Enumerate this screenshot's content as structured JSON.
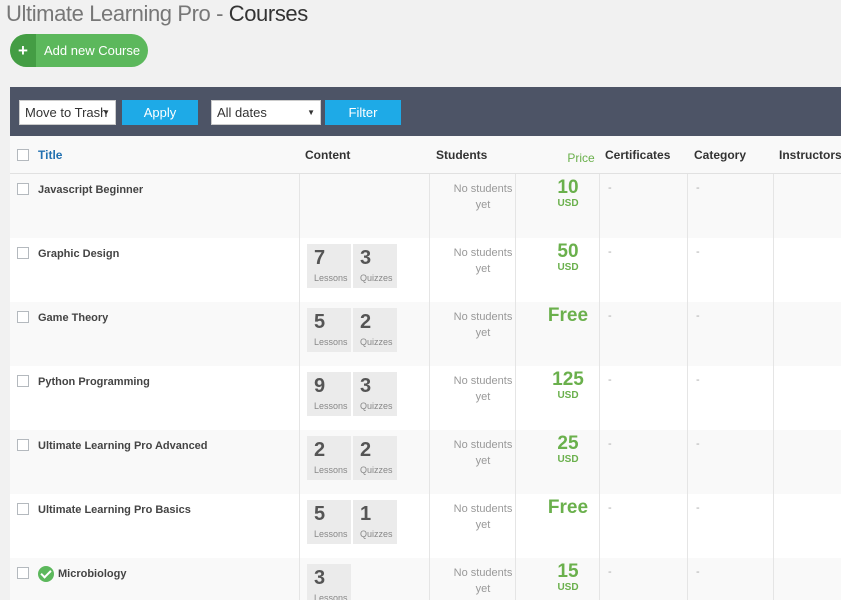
{
  "header": {
    "brand": "Ultimate Learning Pro -",
    "section": "Courses"
  },
  "add_button": {
    "label": "Add new Course",
    "icon": "plus-icon"
  },
  "toolbar": {
    "bulk_action": "Move to Trash",
    "apply": "Apply",
    "dates": "All dates",
    "filter": "Filter"
  },
  "columns": {
    "title": "Title",
    "content": "Content",
    "students": "Students",
    "price": "Price",
    "certificates": "Certificates",
    "category": "Category",
    "instructors": "Instructors"
  },
  "content_labels": {
    "lessons": "Lessons",
    "quizzes": "Quizzes"
  },
  "students_empty": {
    "line1": "No students",
    "line2": "yet"
  },
  "dash": "-",
  "currency": "USD",
  "courses": [
    {
      "title": "Javascript Beginner",
      "lessons": null,
      "quizzes": null,
      "price": "10",
      "free": false,
      "published_icon": false
    },
    {
      "title": "Graphic Design",
      "lessons": "7",
      "quizzes": "3",
      "price": "50",
      "free": false,
      "published_icon": false
    },
    {
      "title": "Game Theory",
      "lessons": "5",
      "quizzes": "2",
      "price": "Free",
      "free": true,
      "published_icon": false
    },
    {
      "title": "Python Programming",
      "lessons": "9",
      "quizzes": "3",
      "price": "125",
      "free": false,
      "published_icon": false
    },
    {
      "title": "Ultimate Learning Pro Advanced",
      "lessons": "2",
      "quizzes": "2",
      "price": "25",
      "free": false,
      "published_icon": false
    },
    {
      "title": "Ultimate Learning Pro Basics",
      "lessons": "5",
      "quizzes": "1",
      "price": "Free",
      "free": true,
      "published_icon": false
    },
    {
      "title": "Microbiology",
      "lessons": "3",
      "quizzes": null,
      "price": "15",
      "free": false,
      "published_icon": true
    }
  ],
  "colors": {
    "accent_green": "#5cb85c",
    "toolbar_bg": "#4d5466",
    "button_blue": "#1eaae7",
    "price_green": "#6ab04c",
    "title_blue": "#2271b1"
  }
}
